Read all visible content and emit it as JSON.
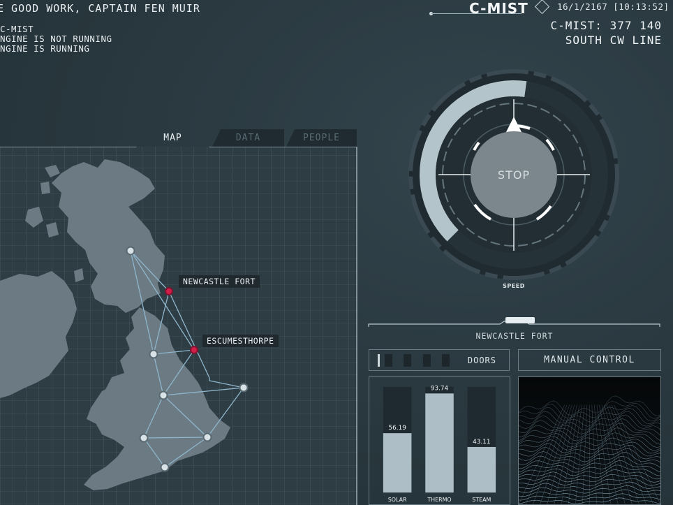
{
  "log": {
    "headline": "E GOOD WORK, CAPTAIN FEN MUIR",
    "lines": [
      "C-MIST",
      "NGINE IS NOT RUNNING",
      "NGINE IS RUNNING"
    ]
  },
  "header": {
    "brand": "C-MIST",
    "date": "16/1/2167",
    "time": "[10:13:52]",
    "datetime": "16/1/2167 [10:13:52]"
  },
  "vessel": {
    "id_line": "C-MIST: 377 140",
    "line_name": "SOUTH CW LINE"
  },
  "tabs": [
    {
      "label": "MAP",
      "active": true
    },
    {
      "label": "DATA",
      "active": false
    },
    {
      "label": "PEOPLE",
      "active": false
    }
  ],
  "map": {
    "labels": {
      "newcastle": "NEWCASTLE FORT",
      "escume": "ESCUMESTHORPE"
    }
  },
  "speed": {
    "button_label": "STOP",
    "gauge_label": "SPEED",
    "level": 0.42
  },
  "station": {
    "name": "NEWCASTLE FORT"
  },
  "doors": {
    "label": "DOORS",
    "segments": 5
  },
  "manual": {
    "label": "MANUAL CONTROL"
  },
  "colors": {
    "background": "#2b3a42",
    "land": "#6b7a83",
    "route": "#8fb6cc",
    "station_red": "#d11d47",
    "bar": "#aebec6"
  },
  "chart_data": {
    "type": "bar",
    "categories": [
      "SOLAR",
      "THERMO",
      "STEAM"
    ],
    "values": [
      56.19,
      93.74,
      43.11
    ],
    "value_labels": [
      "56.19",
      "93.74",
      "43.11"
    ],
    "ylim": [
      0,
      100
    ]
  }
}
